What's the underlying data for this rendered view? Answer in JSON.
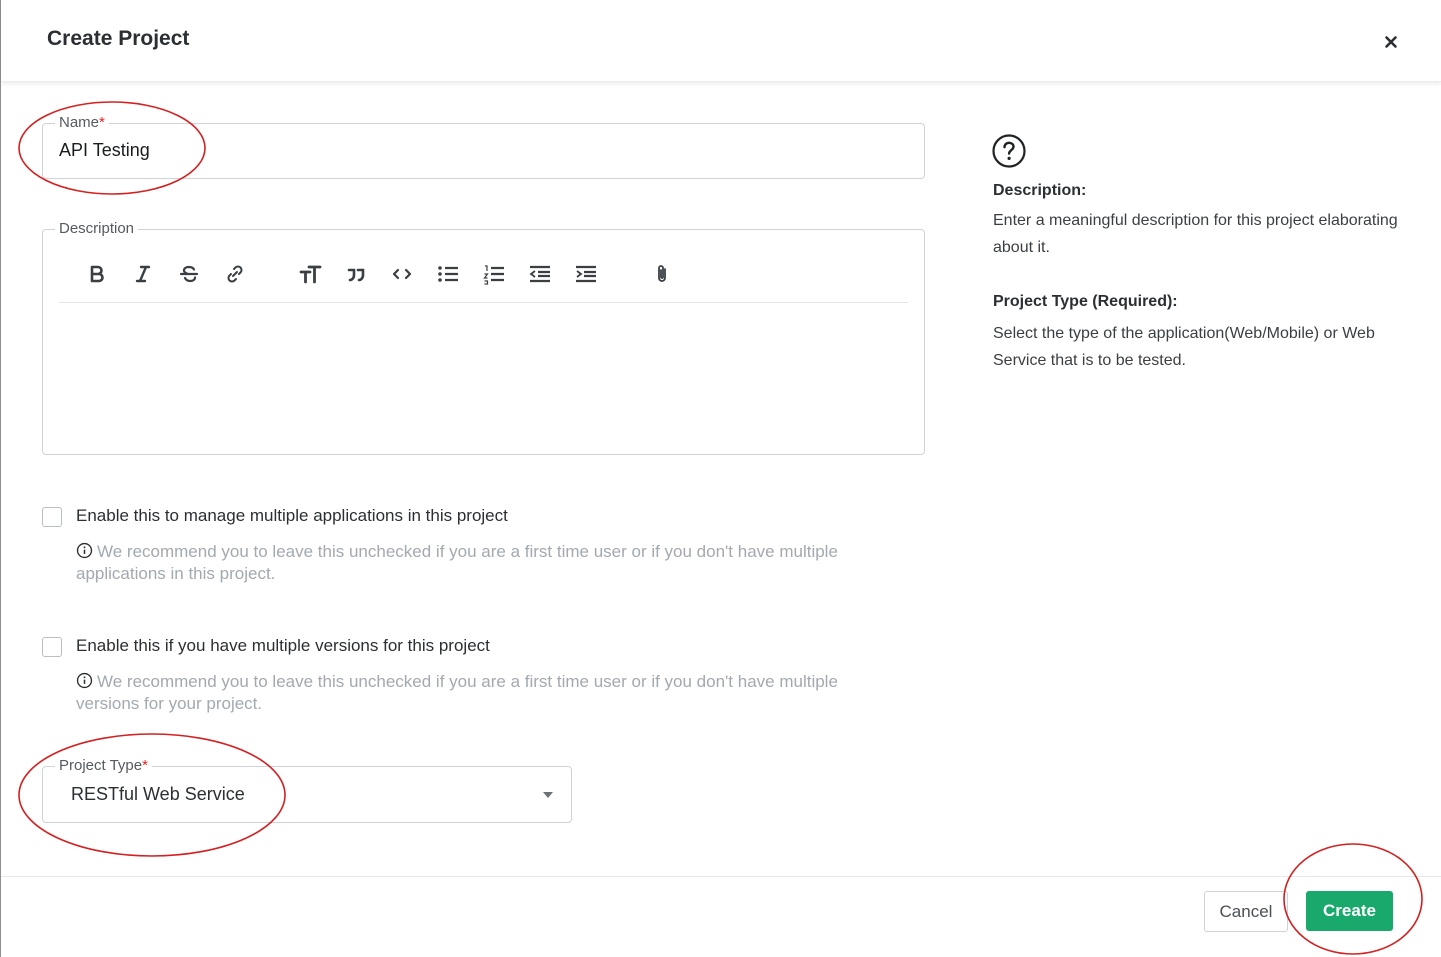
{
  "dialog": {
    "title": "Create Project",
    "close_icon": "close-icon"
  },
  "form": {
    "name": {
      "label": "Name",
      "required_mark": "*",
      "value": "API Testing"
    },
    "description": {
      "label": "Description",
      "toolbar": [
        "bold-icon",
        "italic-icon",
        "strikethrough-icon",
        "link-icon",
        "heading-icon",
        "quote-icon",
        "code-icon",
        "bullet-list-icon",
        "numbered-list-icon",
        "outdent-icon",
        "indent-icon",
        "attachment-icon"
      ],
      "value": ""
    },
    "multiple_apps": {
      "label": "Enable this to manage multiple applications in this project",
      "checked": false,
      "hint": "We recommend you to leave this unchecked if you are a first time user or if you don't have multiple applications in this project."
    },
    "multiple_versions": {
      "label": "Enable this if you have multiple versions for this project",
      "checked": false,
      "hint": "We recommend you to leave this unchecked if you are a first time user or if you don't have multiple versions for your project."
    },
    "project_type": {
      "label": "Project Type",
      "required_mark": "*",
      "value": "RESTful Web Service"
    }
  },
  "help": {
    "icon": "question-circle-icon",
    "description_heading": "Description:",
    "description_text": "Enter a meaningful description for this project elaborating about it.",
    "type_heading": "Project Type (Required):",
    "type_text": "Select the type of the application(Web/Mobile) or Web Service that is to be tested."
  },
  "footer": {
    "cancel_label": "Cancel",
    "create_label": "Create"
  },
  "colors": {
    "primary_button": "#1aa96d",
    "required_mark": "#e02424",
    "annotation": "#d42020"
  }
}
